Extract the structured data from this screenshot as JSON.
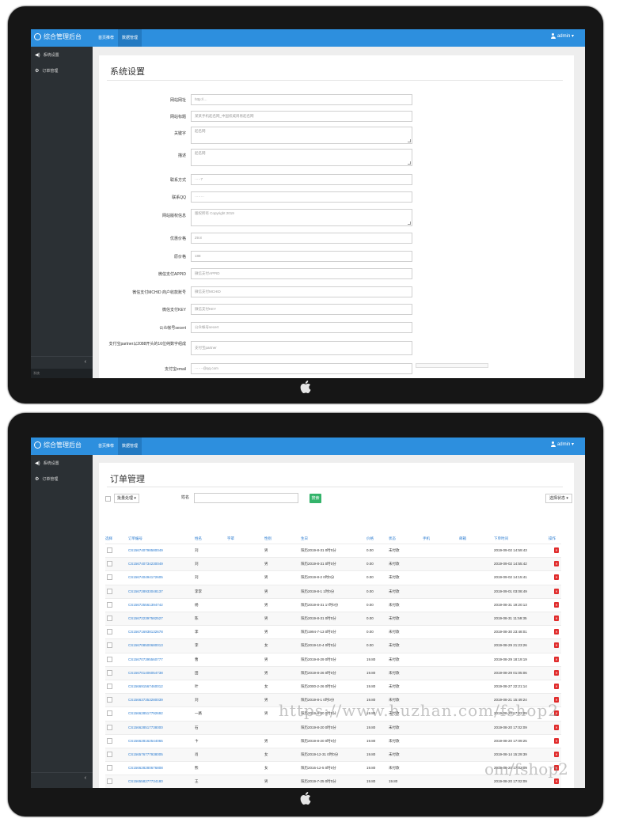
{
  "app": {
    "title": "综合管理后台",
    "tabs": [
      "首页推荐",
      "数据管理"
    ],
    "user": "admin ▾",
    "sidebar": [
      {
        "icon": "megaphone-icon",
        "label": "系统设置"
      },
      {
        "icon": "gear-icon",
        "label": "订单管理"
      }
    ],
    "collapse": "‹",
    "footer": "系统"
  },
  "settings": {
    "title": "系统设置",
    "fields": [
      {
        "label": "网站网址",
        "value": "http://…",
        "type": "input"
      },
      {
        "label": "网站标题",
        "value": "某某手机起名网_中国权威周易起名网",
        "type": "input"
      },
      {
        "label": "关键字",
        "value": "起名网",
        "type": "textarea"
      },
      {
        "label": "描述",
        "value": "起名网",
        "type": "textarea"
      },
      {
        "label": "联系方式",
        "value": "·····7",
        "type": "input"
      },
      {
        "label": "联系QQ",
        "value": "········",
        "type": "input"
      },
      {
        "label": "网站版权信息",
        "value": "版权所有 Copyright 2019",
        "type": "textarea"
      },
      {
        "label": "优惠价格",
        "value": "29.8",
        "type": "input"
      },
      {
        "label": "原价格",
        "value": "188",
        "type": "input"
      },
      {
        "label": "微信支付APPID",
        "value": "微信支付APPID",
        "type": "input"
      },
      {
        "label": "微信支付MCHID 商户收款账号",
        "value": "微信支付MCHID",
        "type": "input"
      },
      {
        "label": "微信支付KEY",
        "value": "微信支付KEY",
        "type": "input"
      },
      {
        "label": "公众帐号secert",
        "value": "公众帐号secert",
        "type": "input"
      },
      {
        "label": "支付宝partner以2088开头的16位纯数字组成",
        "value": "支付宝partner",
        "type": "input2"
      },
      {
        "label": "支付宝email",
        "value": "·······@qq.com",
        "type": "input"
      }
    ]
  },
  "orders": {
    "title": "订单管理",
    "bulk_label": "批量处理 ▾",
    "name_label": "姓名",
    "search_label": "搜索",
    "status_select": "选择状态 ▾",
    "columns": [
      "选择",
      "订单编号",
      "姓名",
      "字辈",
      "性别",
      "生日",
      "价格",
      "状态",
      "手机",
      "邮箱",
      "下单时间",
      "操作"
    ],
    "rows": [
      [
        "CS156740798580049",
        "刘",
        "男",
        "阳历2019-8-31 0时0分",
        "0.00",
        "未付款",
        "2019-09-02 14:59:43"
      ],
      [
        "CS156740734230049",
        "刘",
        "男",
        "阳历2019-8-31 0时0分",
        "0.00",
        "未付款",
        "2019-09-02 14:55:42"
      ],
      [
        "CS156740494172605",
        "刘",
        "男",
        "阳历2019-8-2 0时0分",
        "0.00",
        "未付款",
        "2019-09-02 14:15:41"
      ],
      [
        "CS156728933048137",
        "李李",
        "男",
        "阳历2019-8-1 1时0分",
        "0.00",
        "未付款",
        "2019-09-01 03:08:49"
      ],
      [
        "CS156725561394742",
        "杨",
        "男",
        "阳历2019-8-31 17时0分",
        "0.00",
        "未付款",
        "2019-08-31 19:20:13"
      ],
      [
        "CS156722397582527",
        "陈",
        "男",
        "阳历2019-8-31 0时0分",
        "0.00",
        "未付款",
        "2019-08-31 11:59:35"
      ],
      [
        "CS156716938132678",
        "李",
        "男",
        "阳历1994-7-13 0时0分",
        "0.00",
        "未付款",
        "2019-08-30 23:48:01"
      ],
      [
        "CS156708500680013",
        "李",
        "女",
        "阳历2019-10-4 0时0分",
        "0.00",
        "未付款",
        "2019-08-29 21:23:26"
      ],
      [
        "CS156707395560777",
        "曹",
        "男",
        "阳历2019-8-29 0时0分",
        "19.80",
        "未付款",
        "2019-08-29 18:19:19"
      ],
      [
        "CS156701406054738",
        "田",
        "男",
        "阳历2019-8-26 0时0分",
        "19.80",
        "未付款",
        "2019-08-29 01:05:06"
      ],
      [
        "CS156691567460012",
        "叶",
        "女",
        "阳历2000-2-26 0时0分",
        "19.80",
        "未付款",
        "2019-08-27 22:21:14"
      ],
      [
        "CS156637353280039",
        "刘",
        "男",
        "阳历2019-8-1 0时0分",
        "19.80",
        "未付款",
        "2019-08-21 15:49:24"
      ],
      [
        "CS156628517792692",
        "一路",
        "男",
        "阳历2019-8-20 0时0分",
        "19.80",
        "未付款",
        "2019-08-20 17:02:09"
      ],
      [
        "CS156628517738000",
        "石",
        "",
        "阳历2019-8-20 0时0分",
        "19.80",
        "未付款",
        "2019-08-20 17:02:09"
      ],
      [
        "CS156628162544065",
        "卞",
        "男",
        "阳历2019-8-20 0时0分",
        "19.80",
        "未付款",
        "2019-08-20 17:09:25"
      ],
      [
        "CS156576777938005",
        "肖",
        "女",
        "阳历2019-12-31 0时0分",
        "19.80",
        "未付款",
        "2019-08-14 15:29:39"
      ],
      [
        "CS156628280676808",
        "熊",
        "女",
        "阳历2016-12-5 0时0分",
        "19.80",
        "未付款",
        "2019-08-20 17:02:09"
      ],
      [
        "CS156558277734180",
        "王",
        "男",
        "阳历2019-7-25 0时0分",
        "19.80",
        "19.80",
        "2019-08-20 17:02:09"
      ],
      [
        "CS156480246042260",
        "王",
        "女",
        "阳历2019-7-25 0时0分",
        "19.80",
        "",
        "2019-08-20 17:02:09"
      ]
    ]
  },
  "watermark": {
    "url": "https://www.huzhan.com/fshop2",
    "partial": "om/fshop2"
  }
}
